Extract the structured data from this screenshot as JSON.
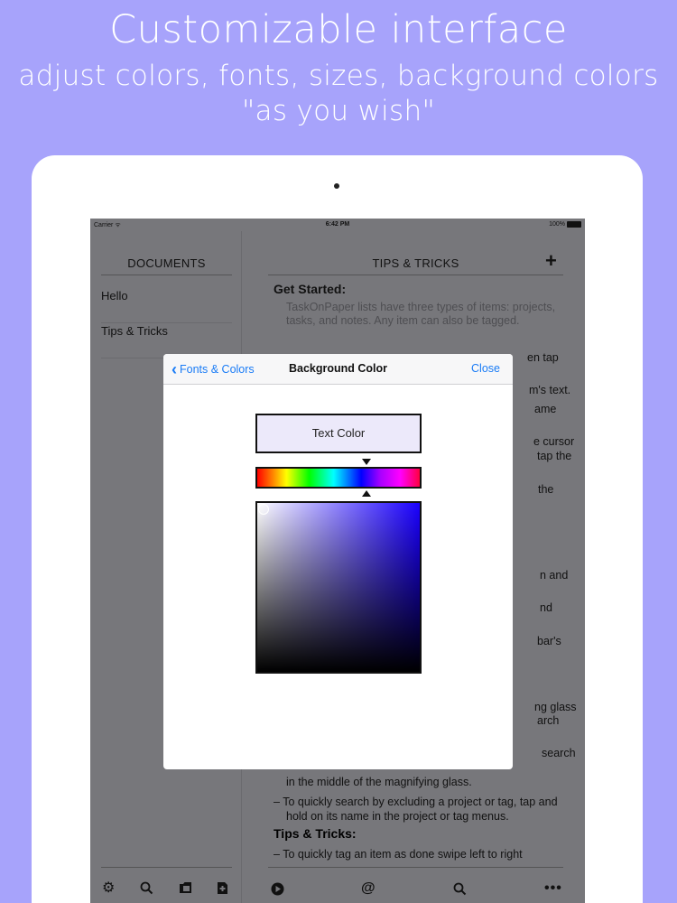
{
  "hero": {
    "title": "Customizable interface",
    "subtitle_line1": "adjust colors, fonts, sizes, background colors",
    "subtitle_line2": "\"as you wish\""
  },
  "status_bar": {
    "carrier": "Carrier ᯤ",
    "time": "6:42 PM",
    "battery": "100%"
  },
  "sidebar": {
    "title": "DOCUMENTS",
    "documents": [
      {
        "label": "Hello"
      },
      {
        "label": "Tips & Tricks"
      }
    ],
    "toolbar_icons": [
      "gear-icon",
      "search-icon",
      "folder-icon",
      "new-document-icon"
    ]
  },
  "main": {
    "title": "TIPS & TRICKS",
    "add_label": "+",
    "heading_started": "Get Started:",
    "intro_note": "TaskOnPaper lists have three types of items: projects, tasks, and notes. Any item can also be tagged.",
    "fragments": [
      "en tap",
      "m's text.",
      "ame",
      "e cursor",
      "tap the",
      "the",
      "n and",
      "nd",
      "bar's",
      "ng glass",
      "arch",
      "search"
    ],
    "task_magnify_line": "in the middle of the magnifying glass.",
    "task_exclude": "– To quickly search by excluding a project or tag, tap and hold on its name in the project or tag menus.",
    "heading_tips": "Tips & Tricks:",
    "task_swipe": "– To quickly tag an item as done swipe left to right",
    "toolbar_icons": [
      "play-icon",
      "at-icon",
      "search-icon",
      "more-icon"
    ]
  },
  "modal": {
    "back_label": "Fonts & Colors",
    "title": "Background Color",
    "close_label": "Close",
    "swatch_label": "Text Color",
    "selected_hue_position": 0.67,
    "swatch_color": "#ece9fa",
    "picker_base_color": "#1a00ff"
  },
  "colors": {
    "background": "#a7a3fb",
    "link": "#1a7cf6"
  }
}
